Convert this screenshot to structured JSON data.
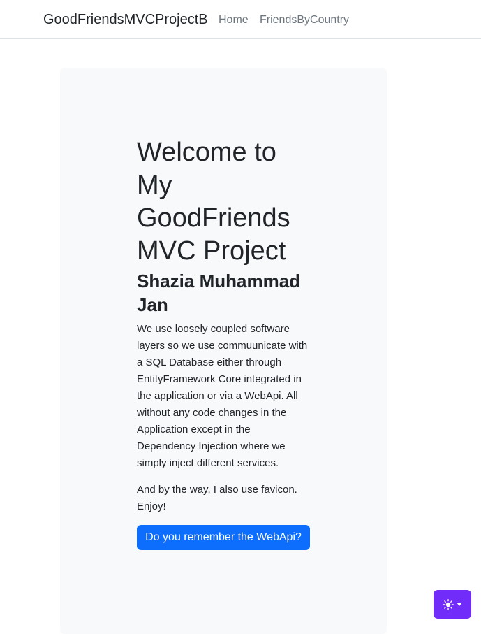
{
  "navbar": {
    "brand": "GoodFriendsMVCProjectB",
    "links": [
      "Home",
      "FriendsByCountry"
    ]
  },
  "hero": {
    "title": "Welcome to My GoodFriends MVC Project",
    "subtitle": "Shazia Muhammad Jan",
    "paragraph1": "We use loosely coupled software layers so we use commuunicate with a SQL Database either through EntityFramework Core integrated in the application or via a WebApi. All without any code changes in the Application except in the Dependency Injection where we simply inject different services.",
    "paragraph2": "And by the way, I also use favicon. Enjoy!",
    "button_label": "Do you remember the WebApi?"
  },
  "theme_toggle": {
    "icon": "sun-icon",
    "color": "#712cf9"
  },
  "colors": {
    "primary": "#0d6efd",
    "hero_background": "#f8f9fa",
    "muted_link": "#6c757d"
  }
}
